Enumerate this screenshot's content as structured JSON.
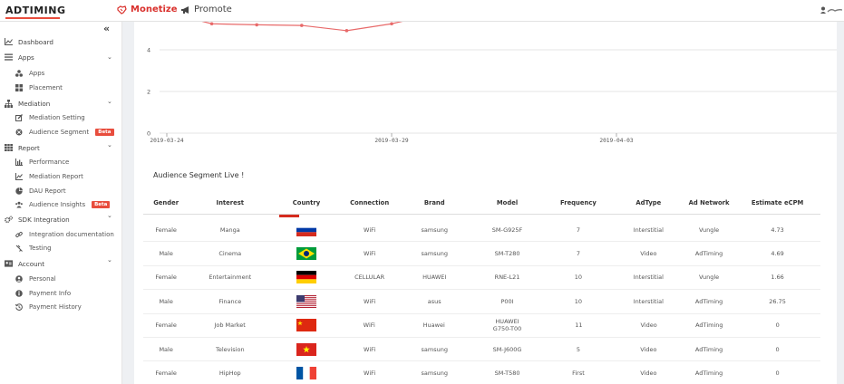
{
  "header": {
    "logo": "ADTIMING",
    "nav": [
      {
        "label": "Monetize",
        "icon": "handshake-icon",
        "active": true
      },
      {
        "label": "Promote",
        "icon": "megaphone-icon",
        "active": false
      }
    ],
    "user_icon": "user-icon"
  },
  "sidebar": {
    "collapse_icon": "«",
    "groups": [
      {
        "label": "Dashboard",
        "icon": "chart-line-icon",
        "items": []
      },
      {
        "label": "Apps",
        "icon": "list-icon",
        "items": [
          {
            "label": "Apps",
            "icon": "apps-icon"
          },
          {
            "label": "Placement",
            "icon": "grid-icon"
          }
        ]
      },
      {
        "label": "Mediation",
        "icon": "sitemap-icon",
        "items": [
          {
            "label": "Mediation Setting",
            "icon": "edit-icon"
          },
          {
            "label": "Audience Segment",
            "icon": "target-icon",
            "badge": "Beta"
          }
        ]
      },
      {
        "label": "Report",
        "icon": "table-icon",
        "items": [
          {
            "label": "Performance",
            "icon": "bar-chart-icon"
          },
          {
            "label": "Mediation Report",
            "icon": "line-chart-icon"
          },
          {
            "label": "DAU Report",
            "icon": "pie-chart-icon"
          },
          {
            "label": "Audience Insights",
            "icon": "users-icon",
            "badge": "Beta"
          }
        ]
      },
      {
        "label": "SDK Integration",
        "icon": "gears-icon",
        "items": [
          {
            "label": "Integration documentation",
            "icon": "link-icon"
          },
          {
            "label": "Testing",
            "icon": "plug-icon"
          }
        ]
      },
      {
        "label": "Account",
        "icon": "id-card-icon",
        "items": [
          {
            "label": "Personal",
            "icon": "person-circle-icon"
          },
          {
            "label": "Payment Info",
            "icon": "info-icon"
          },
          {
            "label": "Payment History",
            "icon": "history-icon"
          }
        ]
      }
    ]
  },
  "chart_data": {
    "type": "line",
    "x_ticks": [
      "2019-03-24",
      "2019-03-29",
      "2019-04-03"
    ],
    "y_ticks": [
      "0",
      "2",
      "4"
    ],
    "ylim": [
      0,
      6
    ],
    "grid": true,
    "color": "#e86a6a",
    "series": [
      {
        "x": [
          "2019-03-24",
          "2019-03-25",
          "2019-03-26",
          "2019-03-27",
          "2019-03-28",
          "2019-03-29",
          "2019-03-30",
          "2019-03-31"
        ],
        "y": [
          5.8,
          5.25,
          5.2,
          5.17,
          4.92,
          5.25,
          5.75,
          6.3
        ]
      }
    ]
  },
  "section_title": "Audience Segment Live !",
  "table": {
    "columns": [
      "Gender",
      "Interest",
      "Country",
      "Connection",
      "Brand",
      "Model",
      "Frequency",
      "AdType",
      "Ad Network",
      "Estimate eCPM"
    ],
    "rows": [
      {
        "gender": "Female",
        "interest": "Manga",
        "country": "russia-flag-icon",
        "connection": "WiFi",
        "brand": "samsung",
        "model": "SM-G925F",
        "frequency": "7",
        "adtype": "Interstitial",
        "network": "Vungle",
        "ecpm": "4.73"
      },
      {
        "gender": "Male",
        "interest": "Cinema",
        "country": "brazil-flag-icon",
        "connection": "WiFi",
        "brand": "samsung",
        "model": "SM-T280",
        "frequency": "7",
        "adtype": "Video",
        "network": "AdTiming",
        "ecpm": "4.69"
      },
      {
        "gender": "Female",
        "interest": "Entertainment",
        "country": "germany-flag-icon",
        "connection": "CELLULAR",
        "brand": "HUAWEI",
        "model": "RNE-L21",
        "frequency": "10",
        "adtype": "Interstitial",
        "network": "Vungle",
        "ecpm": "1.66"
      },
      {
        "gender": "Male",
        "interest": "Finance",
        "country": "usa-flag-icon",
        "connection": "WiFi",
        "brand": "asus",
        "model": "P00I",
        "frequency": "10",
        "adtype": "Interstitial",
        "network": "AdTiming",
        "ecpm": "26.75"
      },
      {
        "gender": "Female",
        "interest": "Job Market",
        "country": "china-flag-icon",
        "connection": "WiFi",
        "brand": "Huawei",
        "model": "HUAWEI G750-T00",
        "frequency": "11",
        "adtype": "Video",
        "network": "AdTiming",
        "ecpm": "0"
      },
      {
        "gender": "Male",
        "interest": "Television",
        "country": "vietnam-flag-icon",
        "connection": "WiFi",
        "brand": "samsung",
        "model": "SM-J600G",
        "frequency": "5",
        "adtype": "Video",
        "network": "AdTiming",
        "ecpm": "0"
      },
      {
        "gender": "Female",
        "interest": "HipHop",
        "country": "france-flag-icon",
        "connection": "WiFi",
        "brand": "samsung",
        "model": "SM-T580",
        "frequency": "First",
        "adtype": "Video",
        "network": "AdTiming",
        "ecpm": "0"
      }
    ]
  }
}
